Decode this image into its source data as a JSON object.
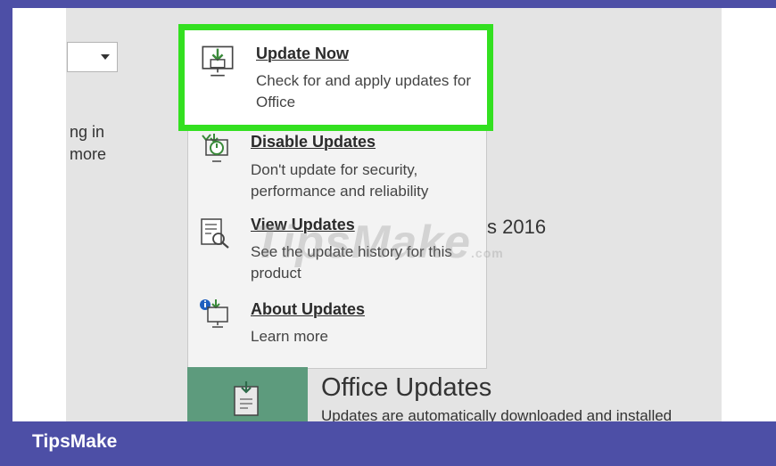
{
  "dropdown": {
    "value": ""
  },
  "side_text": {
    "line1": "ng in",
    "line2": "more"
  },
  "menu": {
    "items": [
      {
        "title": "Update Now",
        "desc": "Check for and apply updates for Office",
        "icon": "download-monitor-icon"
      },
      {
        "title": "Disable Updates",
        "desc": "Don't update for security, performance and reliability",
        "icon": "disable-updates-icon"
      },
      {
        "title": "View Updates",
        "desc": "See the update history for this product",
        "icon": "view-history-icon"
      },
      {
        "title": "About Updates",
        "desc": "Learn more",
        "icon": "info-monitor-icon"
      }
    ]
  },
  "version_text": "s 2016",
  "office_updates": {
    "title": "Office Updates",
    "desc": "Updates are automatically downloaded and installed"
  },
  "watermark": {
    "text": "TipsMake",
    "suffix": ".com"
  },
  "footer": {
    "brand": "TipsMake"
  },
  "colors": {
    "highlight": "#33e020",
    "brand_bar": "#4d4fa6",
    "tile": "#5d9b7d"
  }
}
